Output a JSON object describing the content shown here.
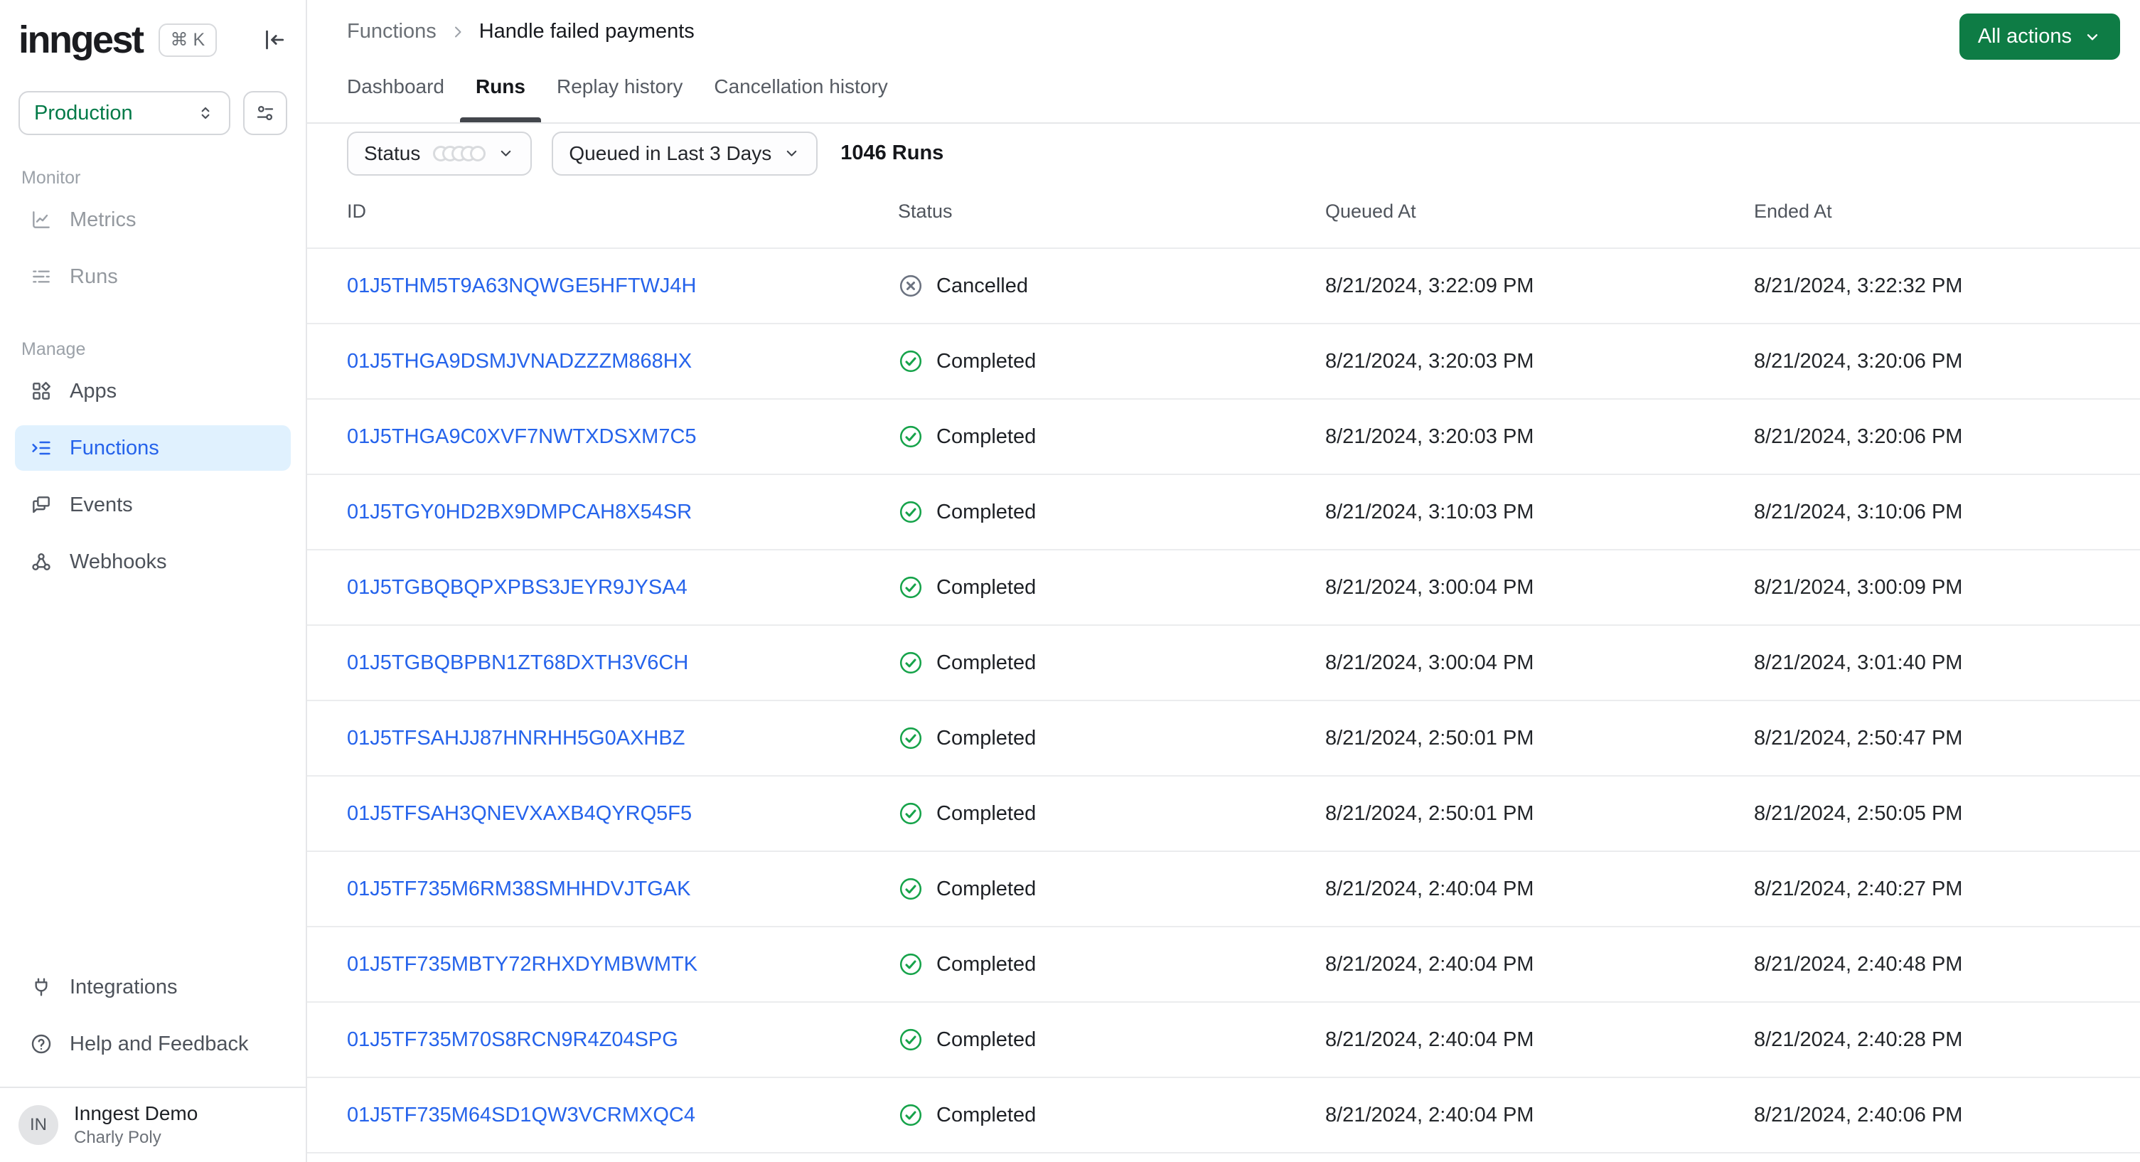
{
  "sidebar": {
    "logo": "inngest",
    "kbd_shortcut": "⌘ K",
    "environment": "Production",
    "sections": [
      {
        "label": "Monitor",
        "items": [
          {
            "label": "Metrics",
            "icon": "metrics-icon"
          },
          {
            "label": "Runs",
            "icon": "runs-icon"
          }
        ]
      },
      {
        "label": "Manage",
        "items": [
          {
            "label": "Apps",
            "icon": "apps-icon"
          },
          {
            "label": "Functions",
            "icon": "functions-icon",
            "active": true
          },
          {
            "label": "Events",
            "icon": "events-icon"
          },
          {
            "label": "Webhooks",
            "icon": "webhook-icon"
          }
        ]
      }
    ],
    "footer_items": [
      {
        "label": "Integrations",
        "icon": "plug-icon"
      },
      {
        "label": "Help and Feedback",
        "icon": "help-icon"
      }
    ],
    "user": {
      "initials": "IN",
      "org": "Inngest Demo",
      "name": "Charly Poly"
    }
  },
  "header": {
    "breadcrumb": [
      "Functions",
      "Handle failed payments"
    ],
    "tabs": [
      {
        "label": "Dashboard"
      },
      {
        "label": "Runs",
        "active": true
      },
      {
        "label": "Replay history"
      },
      {
        "label": "Cancellation history"
      }
    ],
    "all_actions_label": "All actions"
  },
  "filters": {
    "status_label": "Status",
    "time_range": "Queued in Last 3 Days",
    "runs_count": "1046 Runs"
  },
  "table": {
    "columns": [
      "ID",
      "Status",
      "Queued At",
      "Ended At"
    ],
    "rows": [
      {
        "id": "01J5THM5T9A63NQWGE5HFTWJ4H",
        "status": "Cancelled",
        "queued_at": "8/21/2024, 3:22:09 PM",
        "ended_at": "8/21/2024, 3:22:32 PM"
      },
      {
        "id": "01J5THGA9DSMJVNADZZZM868HX",
        "status": "Completed",
        "queued_at": "8/21/2024, 3:20:03 PM",
        "ended_at": "8/21/2024, 3:20:06 PM"
      },
      {
        "id": "01J5THGA9C0XVF7NWTXDSXM7C5",
        "status": "Completed",
        "queued_at": "8/21/2024, 3:20:03 PM",
        "ended_at": "8/21/2024, 3:20:06 PM"
      },
      {
        "id": "01J5TGY0HD2BX9DMPCAH8X54SR",
        "status": "Completed",
        "queued_at": "8/21/2024, 3:10:03 PM",
        "ended_at": "8/21/2024, 3:10:06 PM"
      },
      {
        "id": "01J5TGBQBQPXPBS3JEYR9JYSA4",
        "status": "Completed",
        "queued_at": "8/21/2024, 3:00:04 PM",
        "ended_at": "8/21/2024, 3:00:09 PM"
      },
      {
        "id": "01J5TGBQBPBN1ZT68DXTH3V6CH",
        "status": "Completed",
        "queued_at": "8/21/2024, 3:00:04 PM",
        "ended_at": "8/21/2024, 3:01:40 PM"
      },
      {
        "id": "01J5TFSAHJJ87HNRHH5G0AXHBZ",
        "status": "Completed",
        "queued_at": "8/21/2024, 2:50:01 PM",
        "ended_at": "8/21/2024, 2:50:47 PM"
      },
      {
        "id": "01J5TFSAH3QNEVXAXB4QYRQ5F5",
        "status": "Completed",
        "queued_at": "8/21/2024, 2:50:01 PM",
        "ended_at": "8/21/2024, 2:50:05 PM"
      },
      {
        "id": "01J5TF735M6RM38SMHHDVJTGAK",
        "status": "Completed",
        "queued_at": "8/21/2024, 2:40:04 PM",
        "ended_at": "8/21/2024, 2:40:27 PM"
      },
      {
        "id": "01J5TF735MBTY72RHXDYMBWMTK",
        "status": "Completed",
        "queued_at": "8/21/2024, 2:40:04 PM",
        "ended_at": "8/21/2024, 2:40:48 PM"
      },
      {
        "id": "01J5TF735M70S8RCN9R4Z04SPG",
        "status": "Completed",
        "queued_at": "8/21/2024, 2:40:04 PM",
        "ended_at": "8/21/2024, 2:40:28 PM"
      },
      {
        "id": "01J5TF735M64SD1QW3VCRMXQC4",
        "status": "Completed",
        "queued_at": "8/21/2024, 2:40:04 PM",
        "ended_at": "8/21/2024, 2:40:06 PM"
      }
    ]
  },
  "colors": {
    "accent_green": "#0e7c45",
    "env_green": "#027a48",
    "link_blue": "#2563eb",
    "completed_green": "#16a34a",
    "cancelled_gray": "#6b7280",
    "active_nav_bg": "#e0f1fe",
    "active_nav_text": "#2563eb"
  }
}
